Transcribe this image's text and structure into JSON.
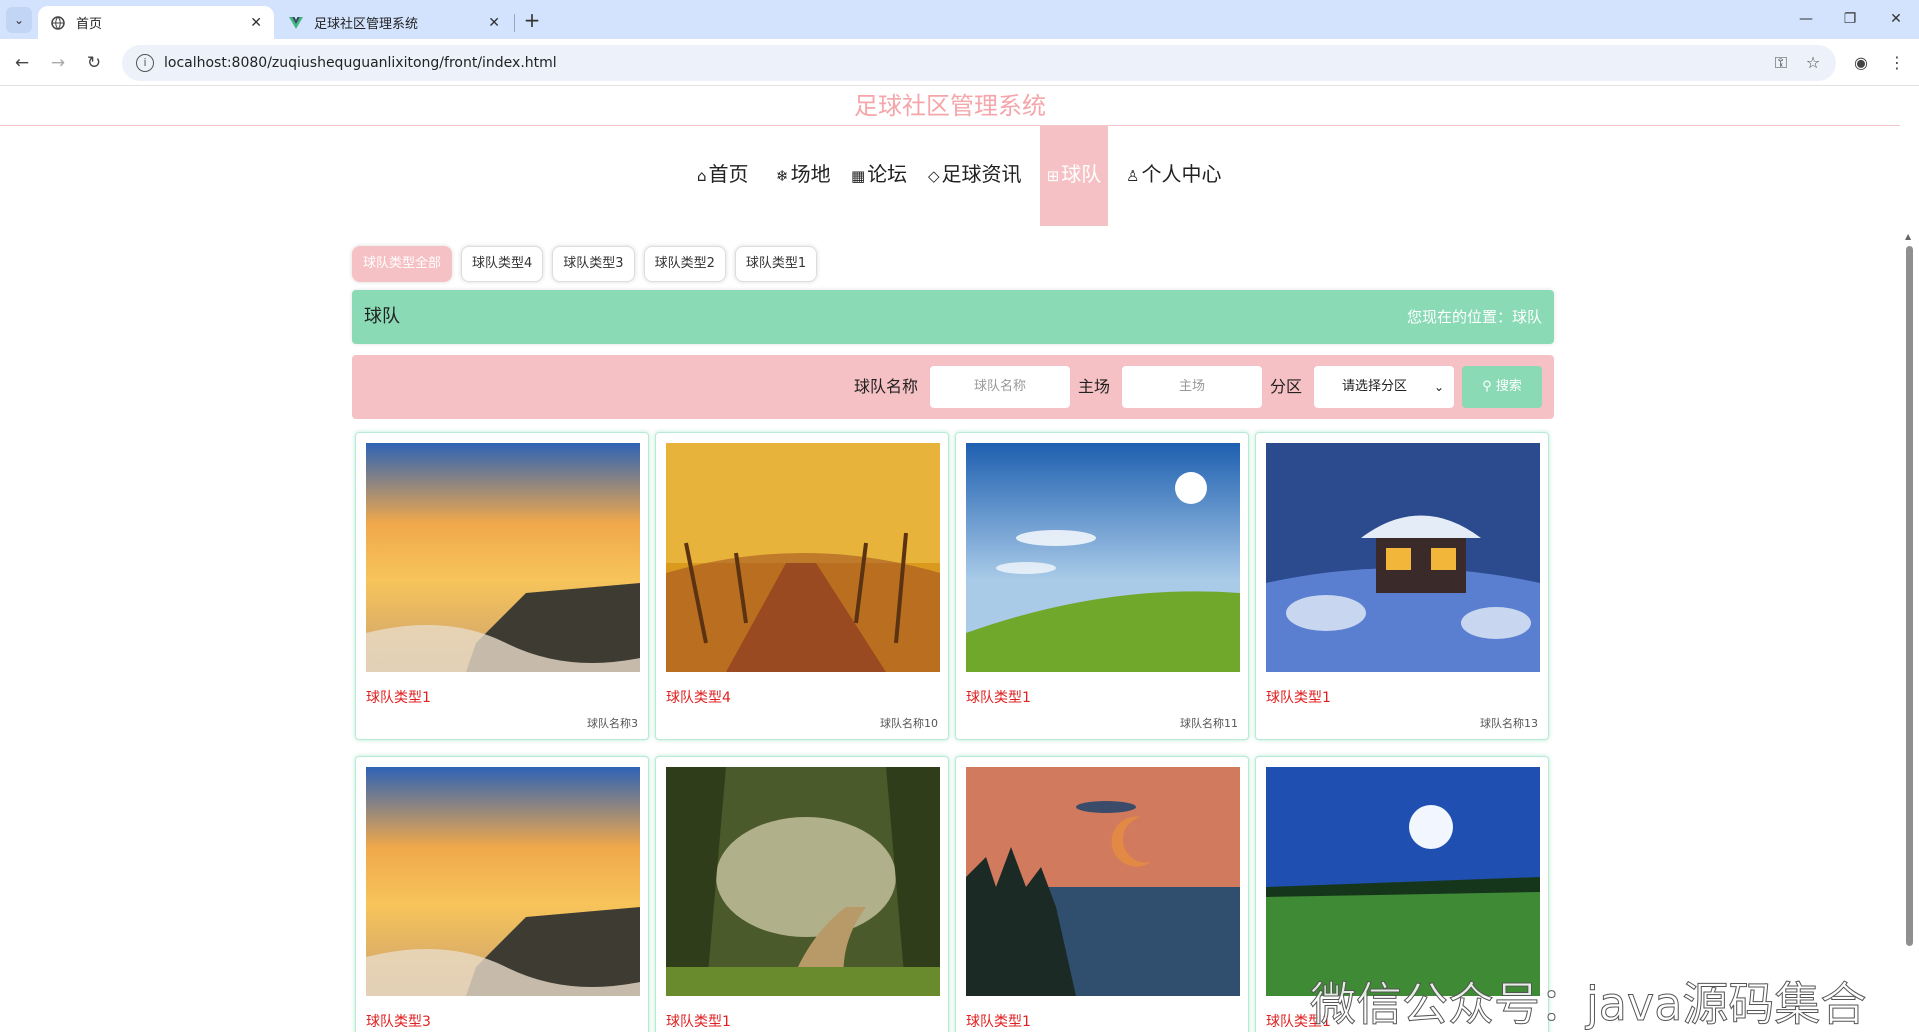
{
  "browser": {
    "tabs": [
      {
        "title": "首页",
        "active": true
      },
      {
        "title": "足球社区管理系统",
        "active": false
      }
    ],
    "url": "localhost:8080/zuqiushequguanlixitong/front/index.html"
  },
  "site": {
    "title": "足球社区管理系统"
  },
  "nav": [
    {
      "label": "首页",
      "icon": "home-icon",
      "active": false
    },
    {
      "label": "场地",
      "icon": "snowflake-icon",
      "active": false
    },
    {
      "label": "论坛",
      "icon": "calendar-icon",
      "active": false
    },
    {
      "label": "足球资讯",
      "icon": "tag-icon",
      "active": false
    },
    {
      "label": "球队",
      "icon": "gift-icon",
      "active": true
    },
    {
      "label": "个人中心",
      "icon": "user-icon",
      "active": false
    }
  ],
  "categories": [
    "球队类型全部",
    "球队类型4",
    "球队类型3",
    "球队类型2",
    "球队类型1"
  ],
  "banner": {
    "title": "球队",
    "location": "您现在的位置：球队"
  },
  "search": {
    "name_label": "球队名称",
    "name_placeholder": "球队名称",
    "home_label": "主场",
    "home_placeholder": "主场",
    "region_label": "分区",
    "region_value": "请选择分区",
    "button_label": "搜索"
  },
  "cards": [
    {
      "type": "球队类型1",
      "name": "球队名称3",
      "image": "sunset-beach"
    },
    {
      "type": "球队类型4",
      "name": "球队名称10",
      "image": "autumn-forest-road"
    },
    {
      "type": "球队类型1",
      "name": "球队名称11",
      "image": "sky-meadow"
    },
    {
      "type": "球队类型1",
      "name": "球队名称13",
      "image": "snow-cabin"
    },
    {
      "type": "球队类型3",
      "name": "",
      "image": "sunset-beach"
    },
    {
      "type": "球队类型1",
      "name": "",
      "image": "misty-forest-path"
    },
    {
      "type": "球队类型1",
      "name": "",
      "image": "lake-moon-sunset"
    },
    {
      "type": "球队类型1",
      "name": "",
      "image": "night-moon-field"
    }
  ],
  "watermark": "微信公众号：java源码集合",
  "colors": {
    "accent_pink": "#f6c1c5",
    "accent_green": "#8adab5",
    "card_type_red": "#e02020"
  }
}
